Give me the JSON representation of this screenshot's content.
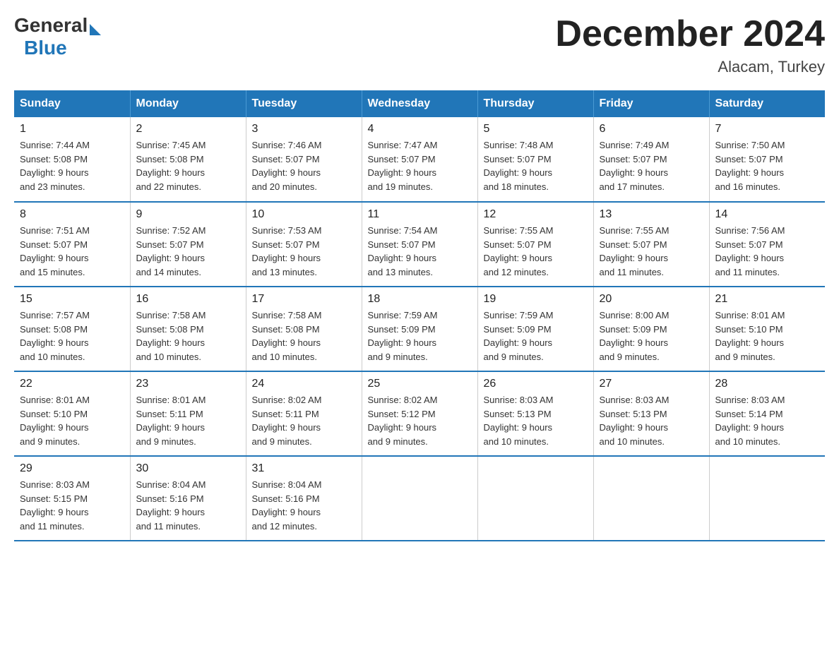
{
  "logo": {
    "general": "General",
    "triangle": "▶",
    "blue": "Blue"
  },
  "title": "December 2024",
  "subtitle": "Alacam, Turkey",
  "days_header": [
    "Sunday",
    "Monday",
    "Tuesday",
    "Wednesday",
    "Thursday",
    "Friday",
    "Saturday"
  ],
  "weeks": [
    [
      {
        "day": "1",
        "sunrise": "7:44 AM",
        "sunset": "5:08 PM",
        "daylight": "9 hours and 23 minutes."
      },
      {
        "day": "2",
        "sunrise": "7:45 AM",
        "sunset": "5:08 PM",
        "daylight": "9 hours and 22 minutes."
      },
      {
        "day": "3",
        "sunrise": "7:46 AM",
        "sunset": "5:07 PM",
        "daylight": "9 hours and 20 minutes."
      },
      {
        "day": "4",
        "sunrise": "7:47 AM",
        "sunset": "5:07 PM",
        "daylight": "9 hours and 19 minutes."
      },
      {
        "day": "5",
        "sunrise": "7:48 AM",
        "sunset": "5:07 PM",
        "daylight": "9 hours and 18 minutes."
      },
      {
        "day": "6",
        "sunrise": "7:49 AM",
        "sunset": "5:07 PM",
        "daylight": "9 hours and 17 minutes."
      },
      {
        "day": "7",
        "sunrise": "7:50 AM",
        "sunset": "5:07 PM",
        "daylight": "9 hours and 16 minutes."
      }
    ],
    [
      {
        "day": "8",
        "sunrise": "7:51 AM",
        "sunset": "5:07 PM",
        "daylight": "9 hours and 15 minutes."
      },
      {
        "day": "9",
        "sunrise": "7:52 AM",
        "sunset": "5:07 PM",
        "daylight": "9 hours and 14 minutes."
      },
      {
        "day": "10",
        "sunrise": "7:53 AM",
        "sunset": "5:07 PM",
        "daylight": "9 hours and 13 minutes."
      },
      {
        "day": "11",
        "sunrise": "7:54 AM",
        "sunset": "5:07 PM",
        "daylight": "9 hours and 13 minutes."
      },
      {
        "day": "12",
        "sunrise": "7:55 AM",
        "sunset": "5:07 PM",
        "daylight": "9 hours and 12 minutes."
      },
      {
        "day": "13",
        "sunrise": "7:55 AM",
        "sunset": "5:07 PM",
        "daylight": "9 hours and 11 minutes."
      },
      {
        "day": "14",
        "sunrise": "7:56 AM",
        "sunset": "5:07 PM",
        "daylight": "9 hours and 11 minutes."
      }
    ],
    [
      {
        "day": "15",
        "sunrise": "7:57 AM",
        "sunset": "5:08 PM",
        "daylight": "9 hours and 10 minutes."
      },
      {
        "day": "16",
        "sunrise": "7:58 AM",
        "sunset": "5:08 PM",
        "daylight": "9 hours and 10 minutes."
      },
      {
        "day": "17",
        "sunrise": "7:58 AM",
        "sunset": "5:08 PM",
        "daylight": "9 hours and 10 minutes."
      },
      {
        "day": "18",
        "sunrise": "7:59 AM",
        "sunset": "5:09 PM",
        "daylight": "9 hours and 9 minutes."
      },
      {
        "day": "19",
        "sunrise": "7:59 AM",
        "sunset": "5:09 PM",
        "daylight": "9 hours and 9 minutes."
      },
      {
        "day": "20",
        "sunrise": "8:00 AM",
        "sunset": "5:09 PM",
        "daylight": "9 hours and 9 minutes."
      },
      {
        "day": "21",
        "sunrise": "8:01 AM",
        "sunset": "5:10 PM",
        "daylight": "9 hours and 9 minutes."
      }
    ],
    [
      {
        "day": "22",
        "sunrise": "8:01 AM",
        "sunset": "5:10 PM",
        "daylight": "9 hours and 9 minutes."
      },
      {
        "day": "23",
        "sunrise": "8:01 AM",
        "sunset": "5:11 PM",
        "daylight": "9 hours and 9 minutes."
      },
      {
        "day": "24",
        "sunrise": "8:02 AM",
        "sunset": "5:11 PM",
        "daylight": "9 hours and 9 minutes."
      },
      {
        "day": "25",
        "sunrise": "8:02 AM",
        "sunset": "5:12 PM",
        "daylight": "9 hours and 9 minutes."
      },
      {
        "day": "26",
        "sunrise": "8:03 AM",
        "sunset": "5:13 PM",
        "daylight": "9 hours and 10 minutes."
      },
      {
        "day": "27",
        "sunrise": "8:03 AM",
        "sunset": "5:13 PM",
        "daylight": "9 hours and 10 minutes."
      },
      {
        "day": "28",
        "sunrise": "8:03 AM",
        "sunset": "5:14 PM",
        "daylight": "9 hours and 10 minutes."
      }
    ],
    [
      {
        "day": "29",
        "sunrise": "8:03 AM",
        "sunset": "5:15 PM",
        "daylight": "9 hours and 11 minutes."
      },
      {
        "day": "30",
        "sunrise": "8:04 AM",
        "sunset": "5:16 PM",
        "daylight": "9 hours and 11 minutes."
      },
      {
        "day": "31",
        "sunrise": "8:04 AM",
        "sunset": "5:16 PM",
        "daylight": "9 hours and 12 minutes."
      },
      null,
      null,
      null,
      null
    ]
  ],
  "labels": {
    "sunrise": "Sunrise:",
    "sunset": "Sunset:",
    "daylight": "Daylight:"
  }
}
